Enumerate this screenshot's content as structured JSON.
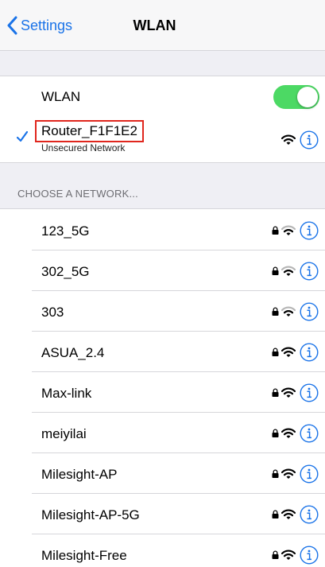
{
  "navbar": {
    "back_label": "Settings",
    "title": "WLAN"
  },
  "wlan_toggle": {
    "label": "WLAN",
    "enabled": true,
    "on_color": "#4cd964"
  },
  "connected": {
    "name": "Router_F1F1E2",
    "subtitle": "Unsecured Network",
    "highlight_color": "#e0261d"
  },
  "section_header": "CHOOSE A NETWORK...",
  "networks": [
    {
      "name": "123_5G",
      "locked": true,
      "signal": "weak"
    },
    {
      "name": "302_5G",
      "locked": true,
      "signal": "weak"
    },
    {
      "name": "303",
      "locked": true,
      "signal": "weak"
    },
    {
      "name": "ASUA_2.4",
      "locked": true,
      "signal": "strong"
    },
    {
      "name": "Max-link",
      "locked": true,
      "signal": "strong"
    },
    {
      "name": "meiyilai",
      "locked": true,
      "signal": "strong"
    },
    {
      "name": "Milesight-AP",
      "locked": true,
      "signal": "strong"
    },
    {
      "name": "Milesight-AP-5G",
      "locked": true,
      "signal": "strong"
    },
    {
      "name": "Milesight-Free",
      "locked": true,
      "signal": "strong"
    }
  ],
  "colors": {
    "accent": "#1a73e8",
    "group_background": "#efeff4",
    "separator": "#d6d6da"
  }
}
